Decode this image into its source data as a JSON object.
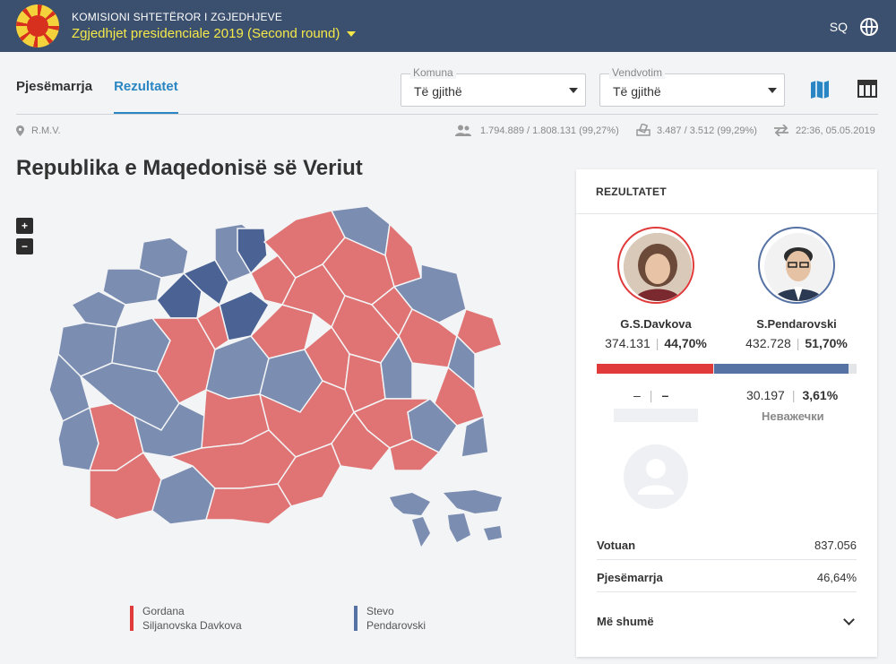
{
  "header": {
    "org": "KOMISIONI SHTETËROR I ZGJEDHJEVE",
    "election": "Zgjedhjet presidenciale 2019 (Second round)",
    "lang": "SQ"
  },
  "tabs": [
    {
      "label": "Pjesëmarrja",
      "active": false
    },
    {
      "label": "Rezultatet",
      "active": true
    }
  ],
  "filters": {
    "komuna": {
      "label": "Komuna",
      "value": "Të gjithë"
    },
    "vendvotim": {
      "label": "Vendvotim",
      "value": "Të gjithë"
    }
  },
  "info": {
    "region": "R.M.V.",
    "voters": "1.794.889 / 1.808.131 (99,27%)",
    "stations": "3.487 / 3.512 (99,29%)",
    "updated": "22:36, 05.05.2019"
  },
  "title": "Republika e Maqedonisë së Veriut",
  "zoom": {
    "in": "+",
    "out": "−"
  },
  "legend": [
    {
      "line1": "Gordana",
      "line2": "Siljanovska Davkova",
      "color": "#e03a3a"
    },
    {
      "line1": "Stevo",
      "line2": "Pendarovski",
      "color": "#5672a4"
    }
  ],
  "results": {
    "heading": "REZULTATET",
    "candidates": [
      {
        "name": "G.S.Davkova",
        "votes": "374.131",
        "percent": "44,70%",
        "share": 44.7,
        "color": "#e03a3a"
      },
      {
        "name": "S.Pendarovski",
        "votes": "432.728",
        "percent": "51,70%",
        "share": 51.7,
        "color": "#5672a4"
      }
    ],
    "other_votes": "–",
    "other_percent": "–",
    "invalid_votes": "30.197",
    "invalid_percent": "3,61%",
    "invalid_label": "Неважечки",
    "stats": [
      {
        "label": "Votuan",
        "value": "837.056"
      },
      {
        "label": "Pjesëmarrja",
        "value": "46,64%"
      }
    ],
    "more": "Më shumë"
  },
  "colors": {
    "red": "#e07373",
    "blue": "#7b8db1",
    "darkblue": "#4a6394"
  }
}
